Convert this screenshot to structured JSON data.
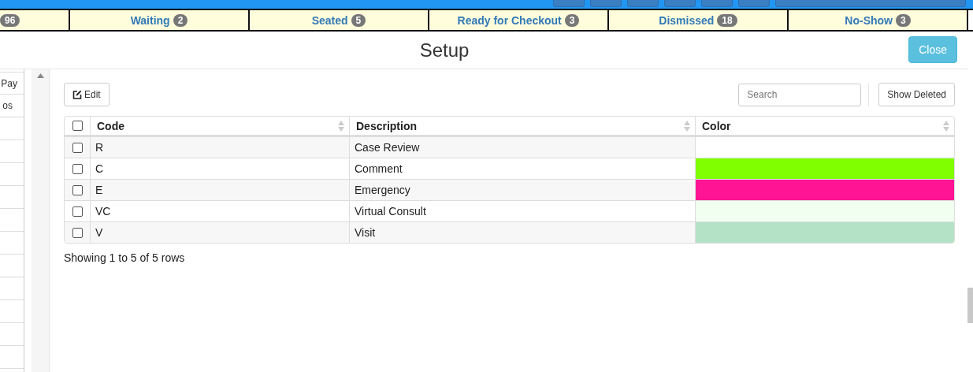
{
  "status_tabs": [
    {
      "count": "96"
    },
    {
      "label": "Waiting",
      "count": "2"
    },
    {
      "label": "Seated",
      "count": "5"
    },
    {
      "label": "Ready for Checkout",
      "count": "3"
    },
    {
      "label": "Dismissed",
      "count": "18"
    },
    {
      "label": "No-Show",
      "count": "3"
    }
  ],
  "sidebar": {
    "items": [
      "Pay",
      "os"
    ]
  },
  "dialog": {
    "title": "Setup",
    "close_button": "Close"
  },
  "toolbar": {
    "edit_button": "Edit",
    "search": {
      "placeholder": "Search"
    },
    "show_deleted_button": "Show Deleted"
  },
  "table": {
    "columns": [
      "Code",
      "Description",
      "Color"
    ],
    "rows": [
      {
        "checked": false,
        "code": "R",
        "description": "Case Review",
        "color": "#ffffff"
      },
      {
        "checked": false,
        "code": "C",
        "description": "Comment",
        "color": "#80ff00"
      },
      {
        "checked": false,
        "code": "E",
        "description": "Emergency",
        "color": "#ff1493"
      },
      {
        "checked": false,
        "code": "VC",
        "description": "Virtual Consult",
        "color": "#f0fff0"
      },
      {
        "checked": false,
        "code": "V",
        "description": "Visit",
        "color": "#b3e2c6"
      }
    ],
    "select_all_checked": false,
    "footer": "Showing 1 to 5 of 5 rows"
  }
}
